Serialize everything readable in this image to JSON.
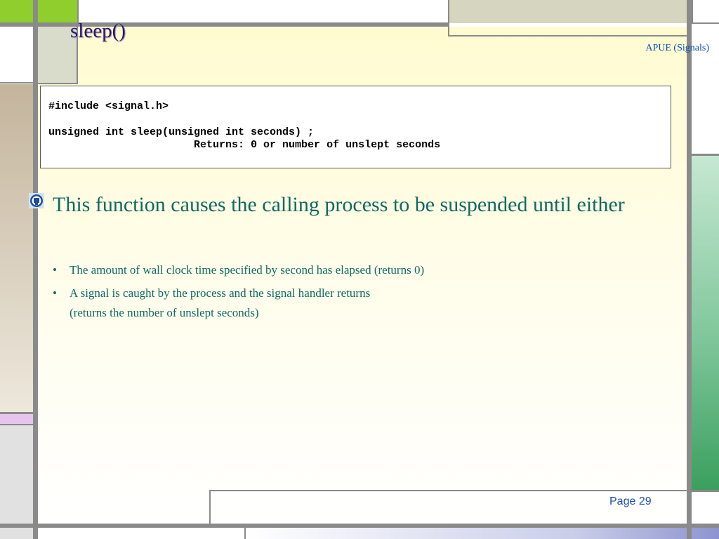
{
  "title": "sleep()",
  "header_note": "APUE (Signals)",
  "code": {
    "line1": "#include <signal.h>",
    "line2": "unsigned int sleep(unsigned int seconds) ;",
    "line3": "                       Returns: 0 or number of unslept seconds"
  },
  "main_bullet": "This function causes the calling process to be suspended until either",
  "sub_bullets": [
    {
      "bullet": "•",
      "line1": "The amount of wall clock time specified by second has elapsed (returns 0)"
    },
    {
      "bullet": "•",
      "line1": "A signal is caught by the process and the signal handler returns",
      "line2": "(returns the number of unslept seconds)"
    }
  ],
  "page_number": "Page 29",
  "icons": {
    "bullet": "university-emblem-icon"
  },
  "colors": {
    "title": "#2a1577",
    "body_text": "#0d6a63",
    "header_note": "#0b4fb5",
    "accent_green": "#8fce2c"
  }
}
